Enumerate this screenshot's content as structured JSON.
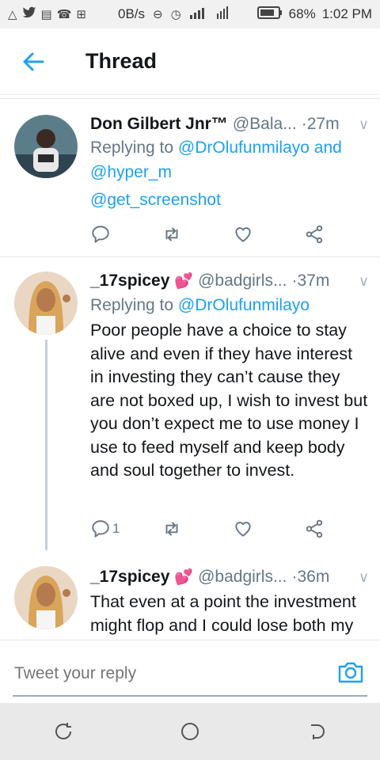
{
  "status_bar": {
    "left_icons": [
      "alert-triangle-icon",
      "twitter-icon",
      "gallery-icon",
      "whatsapp-icon",
      "plus-badge-icon"
    ],
    "data_speed": "0B/s",
    "battery_percent": "68%",
    "time": "1:02 PM"
  },
  "header": {
    "title": "Thread"
  },
  "tweets": [
    {
      "name": "Don Gilbert Jnr™",
      "handle": "@Bala...",
      "time": "·27m",
      "replying_prefix": "Replying to ",
      "mentions_line1": "@DrOlufunmilayo and",
      "mentions_line2": "@hyper_m",
      "mentions_line3": "@get_screenshot",
      "reply_count": "",
      "avatar_color": "#3e5f6e"
    },
    {
      "name": "_17spicey",
      "emoji": "💕",
      "handle": "@badgirls...",
      "time": "·37m",
      "replying_prefix": "Replying to ",
      "mention": "@DrOlufunmilayo",
      "text": "Poor people have a choice to stay alive and even if they have interest in investing they can’t cause they are not boxed up, I wish to invest but you don’t expect me to use money I use to feed myself and keep body and soul together to invest.",
      "reply_count": "1",
      "avatar_color": "#c98f5b"
    },
    {
      "name": "_17spicey",
      "emoji": "💕",
      "handle": "@badgirls...",
      "time": "·36m",
      "text": "That even at a point the investment might flop and I could lose both my",
      "avatar_color": "#c98f5b"
    }
  ],
  "reply_bar": {
    "placeholder": "Tweet your reply"
  },
  "colors": {
    "accent": "#1da1f2",
    "secondary_text": "#657786",
    "heart_emoji": "#d81b60"
  }
}
